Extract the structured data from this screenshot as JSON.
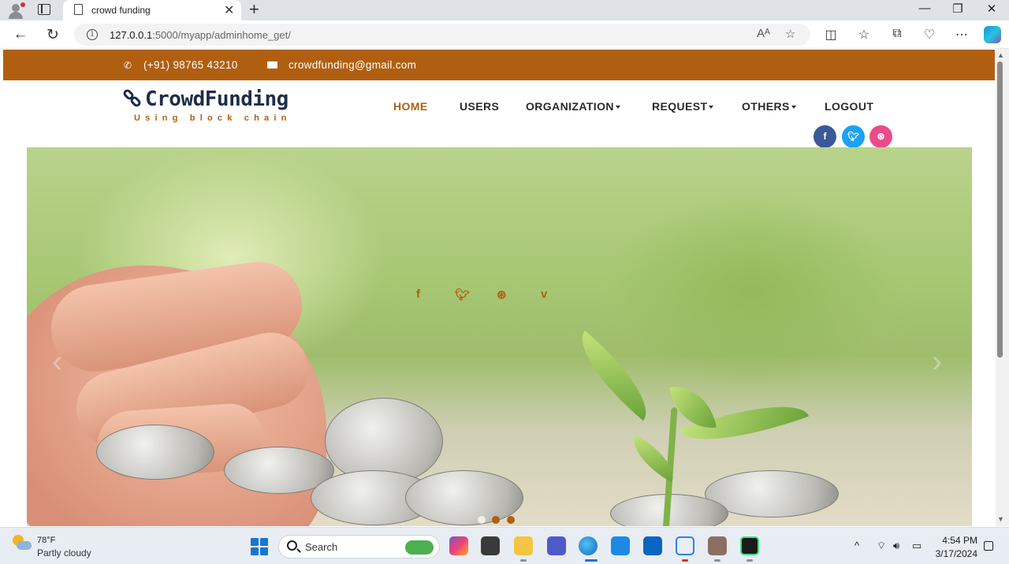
{
  "browser": {
    "tab_title": "crowd funding",
    "url_host": "127.0.0.1",
    "url_rest": ":5000/myapp/adminhome_get/",
    "read_aloud_icon": "read-aloud-icon",
    "favorite_icon": "star-icon"
  },
  "site": {
    "phone": "(+91) 98765 43210",
    "email": "crowdfunding@gmail.com",
    "logo_title": "CrowdFunding",
    "logo_subtitle": "Using block chain",
    "accent_color": "#b05f11",
    "nav": [
      {
        "label": "HOME",
        "active": true,
        "dropdown": false
      },
      {
        "label": "USERS",
        "active": false,
        "dropdown": false
      },
      {
        "label": "ORGANIZATION",
        "active": false,
        "dropdown": true
      },
      {
        "label": "REQUEST",
        "active": false,
        "dropdown": true
      },
      {
        "label": "OTHERS",
        "active": false,
        "dropdown": true
      },
      {
        "label": "LOGOUT",
        "active": false,
        "dropdown": false
      }
    ],
    "social": [
      {
        "name": "facebook-icon",
        "glyph": "f",
        "color": "#3b5998"
      },
      {
        "name": "twitter-icon",
        "glyph": "t",
        "color": "#1da1f2"
      },
      {
        "name": "dribbble-icon",
        "glyph": "⊛",
        "color": "#ea4c89"
      }
    ],
    "hero_social": [
      {
        "name": "facebook-icon",
        "glyph": "f"
      },
      {
        "name": "twitter-icon",
        "glyph": "t"
      },
      {
        "name": "dribbble-icon",
        "glyph": "⊛"
      },
      {
        "name": "vimeo-icon",
        "glyph": "v"
      }
    ],
    "carousel_slides": 3,
    "carousel_active": 1
  },
  "taskbar": {
    "temperature": "78°F",
    "weather": "Partly cloudy",
    "search_label": "Search",
    "time": "4:54 PM",
    "date": "3/17/2024"
  }
}
